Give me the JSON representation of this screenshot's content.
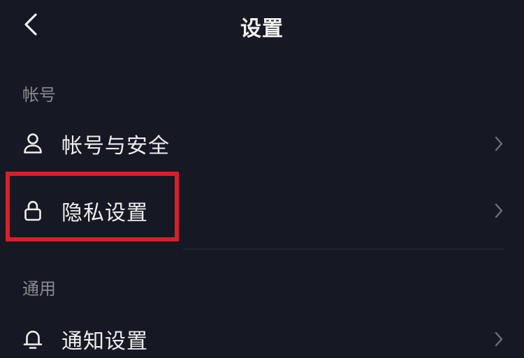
{
  "header": {
    "title": "设置",
    "back_icon": "chevron-left-icon"
  },
  "sections": [
    {
      "title": "帐号",
      "items": [
        {
          "label": "帐号与安全",
          "icon": "user-icon"
        },
        {
          "label": "隐私设置",
          "icon": "lock-icon",
          "highlighted": true
        }
      ]
    },
    {
      "title": "通用",
      "items": [
        {
          "label": "通知设置",
          "icon": "bell-icon"
        }
      ]
    }
  ],
  "colors": {
    "background": "#161823",
    "text": "#eeeef0",
    "section_text": "#8a8b91",
    "chevron": "#6f7077",
    "highlight": "#d8202a"
  }
}
